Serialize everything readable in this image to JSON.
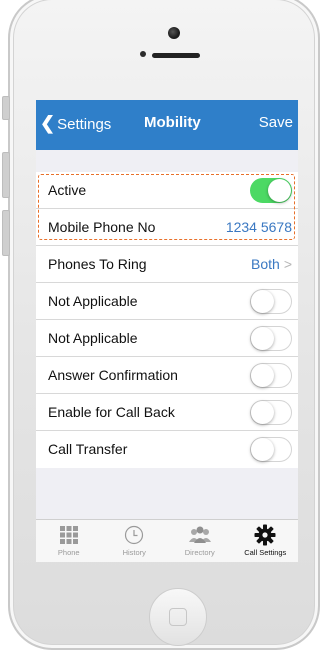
{
  "nav": {
    "back_label": "Settings",
    "title": "Mobility",
    "save_label": "Save"
  },
  "rows": [
    {
      "label": "Active",
      "type": "toggle",
      "on": true
    },
    {
      "label": "Mobile Phone No",
      "type": "value",
      "value": "1234 5678"
    },
    {
      "label": "Phones To Ring",
      "type": "disclosure",
      "value": "Both",
      "chevron": ">"
    },
    {
      "label": "Not Applicable",
      "type": "toggle",
      "on": false
    },
    {
      "label": "Not Applicable",
      "type": "toggle",
      "on": false
    },
    {
      "label": "Answer Confirmation",
      "type": "toggle",
      "on": false
    },
    {
      "label": "Enable for Call Back",
      "type": "toggle",
      "on": false
    },
    {
      "label": "Call Transfer",
      "type": "toggle",
      "on": false
    }
  ],
  "tabs": [
    {
      "label": "Phone",
      "icon": "keypad-icon",
      "active": false
    },
    {
      "label": "History",
      "icon": "clock-icon",
      "active": false
    },
    {
      "label": "Directory",
      "icon": "people-icon",
      "active": false
    },
    {
      "label": "Call Settings",
      "icon": "gear-icon",
      "active": true
    }
  ],
  "colors": {
    "accent": "#2f7fc9",
    "toggle_on": "#4cd964",
    "highlight": "#e8702a",
    "value_text": "#3a78c2"
  }
}
